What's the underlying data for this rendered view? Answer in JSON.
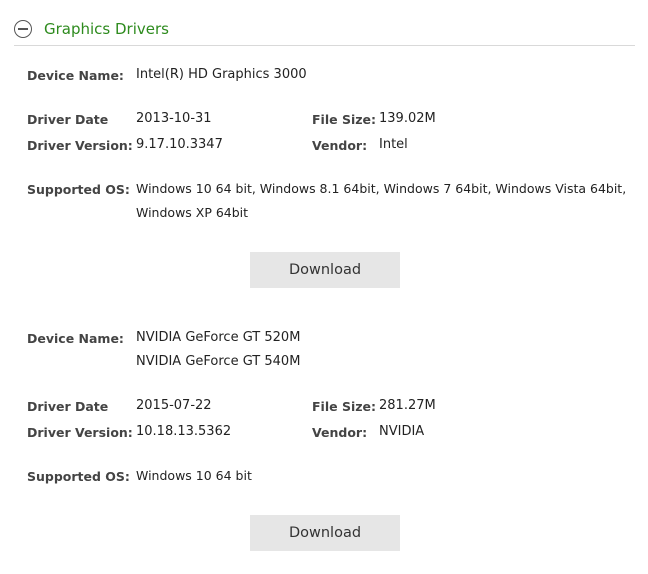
{
  "section": {
    "title": "Graphics Drivers"
  },
  "drivers": [
    {
      "device_name_label": "Device Name:",
      "device_names": [
        "Intel(R) HD Graphics 3000"
      ],
      "driver_date_label": "Driver Date",
      "driver_date": "2013-10-31",
      "file_size_label": "File Size:",
      "file_size": "139.02M",
      "driver_version_label": "Driver Version:",
      "driver_version": "9.17.10.3347",
      "vendor_label": "Vendor:",
      "vendor": "Intel",
      "supported_os_label": "Supported OS:",
      "supported_os_lines": [
        "Windows 10 64 bit, Windows 8.1 64bit, Windows 7 64bit, Windows Vista 64bit,",
        "Windows XP 64bit"
      ],
      "download_label": "Download"
    },
    {
      "device_name_label": "Device Name:",
      "device_names": [
        "NVIDIA GeForce GT 520M",
        "NVIDIA GeForce GT 540M"
      ],
      "driver_date_label": "Driver Date",
      "driver_date": "2015-07-22",
      "file_size_label": "File Size:",
      "file_size": "281.27M",
      "driver_version_label": "Driver Version:",
      "driver_version": "10.18.13.5362",
      "vendor_label": "Vendor:",
      "vendor": "NVIDIA",
      "supported_os_label": "Supported OS:",
      "supported_os_lines": [
        "Windows 10 64 bit"
      ],
      "download_label": "Download"
    }
  ]
}
